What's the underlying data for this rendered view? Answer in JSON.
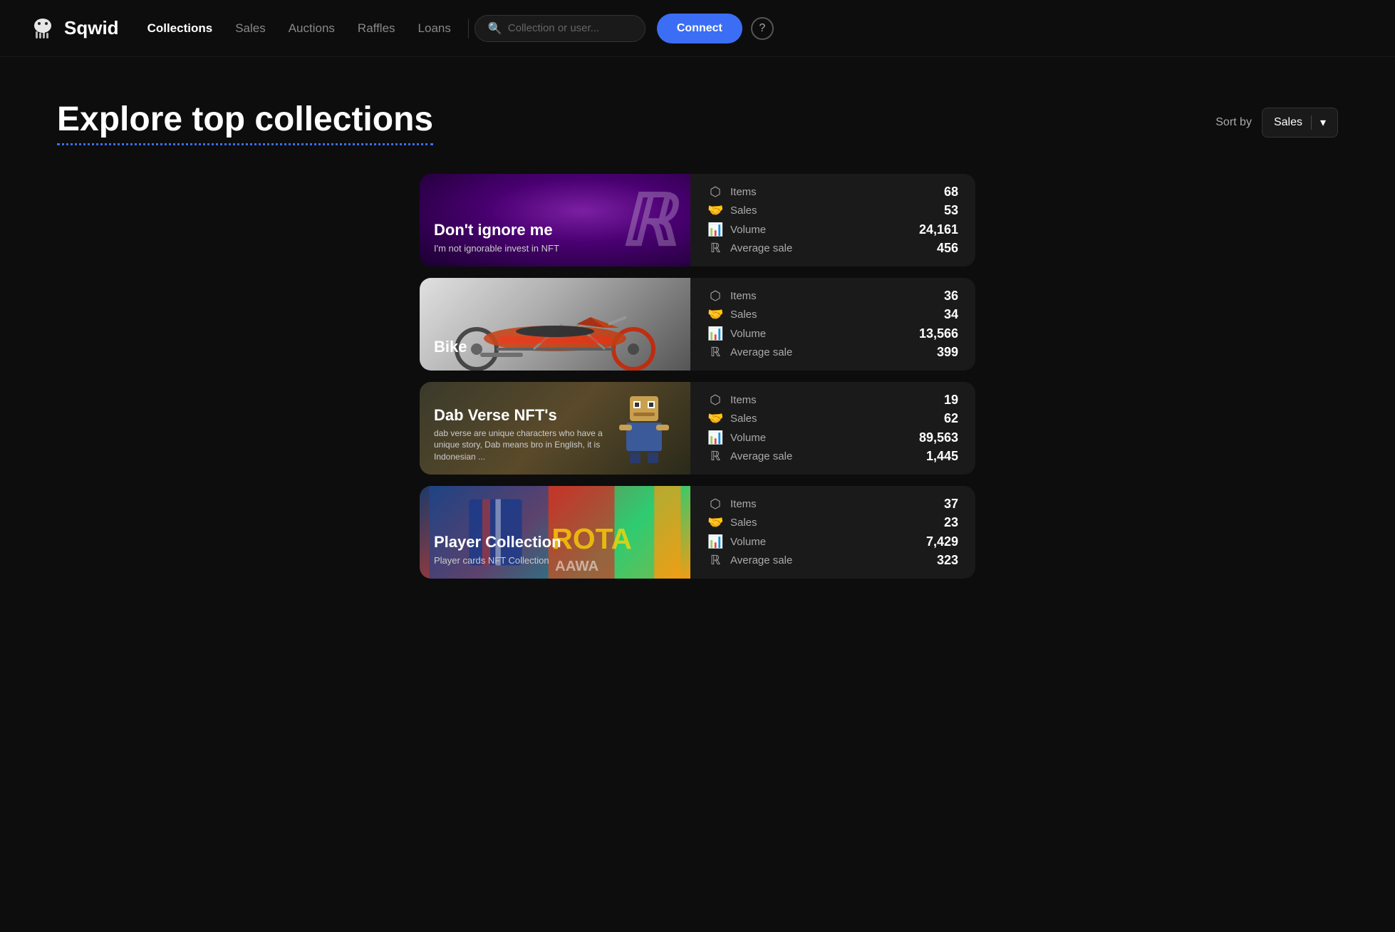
{
  "header": {
    "logo_text": "Sqwid",
    "nav": [
      {
        "label": "Collections",
        "active": true
      },
      {
        "label": "Sales",
        "active": false
      },
      {
        "label": "Auctions",
        "active": false
      },
      {
        "label": "Raffles",
        "active": false
      },
      {
        "label": "Loans",
        "active": false
      }
    ],
    "search_placeholder": "Collection or user...",
    "connect_label": "Connect",
    "help_label": "?"
  },
  "main": {
    "page_title": "Explore top collections",
    "sort_label": "Sort by",
    "sort_value": "Sales",
    "chevron": "▾"
  },
  "collections": [
    {
      "id": 1,
      "name": "Don't ignore me",
      "description": "I'm not ignorable invest in NFT",
      "stats": [
        {
          "label": "Items",
          "value": "68"
        },
        {
          "label": "Sales",
          "value": "53"
        },
        {
          "label": "Volume",
          "value": "24,161"
        },
        {
          "label": "Average sale",
          "value": "456"
        }
      ],
      "theme": "purple"
    },
    {
      "id": 2,
      "name": "Bike",
      "description": "",
      "stats": [
        {
          "label": "Items",
          "value": "36"
        },
        {
          "label": "Sales",
          "value": "34"
        },
        {
          "label": "Volume",
          "value": "13,566"
        },
        {
          "label": "Average sale",
          "value": "399"
        }
      ],
      "theme": "gray"
    },
    {
      "id": 3,
      "name": "Dab Verse NFT's",
      "description": "dab verse are unique characters who have a unique story, Dab means bro in English, it is Indonesian ...",
      "stats": [
        {
          "label": "Items",
          "value": "19"
        },
        {
          "label": "Sales",
          "value": "62"
        },
        {
          "label": "Volume",
          "value": "89,563"
        },
        {
          "label": "Average sale",
          "value": "1,445"
        }
      ],
      "theme": "dark-gold"
    },
    {
      "id": 4,
      "name": "Player Collection",
      "description": "Player cards NFT Collection",
      "stats": [
        {
          "label": "Items",
          "value": "37"
        },
        {
          "label": "Sales",
          "value": "23"
        },
        {
          "label": "Volume",
          "value": "7,429"
        },
        {
          "label": "Average sale",
          "value": "323"
        }
      ],
      "theme": "colorful"
    }
  ]
}
